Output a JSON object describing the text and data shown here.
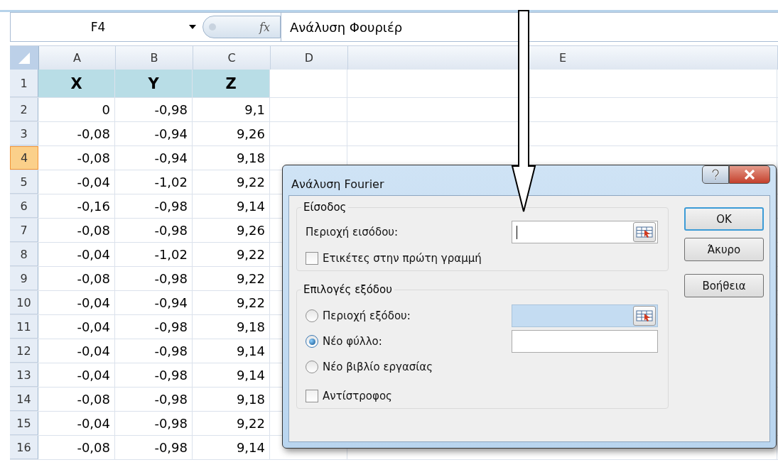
{
  "formula_bar": {
    "name_box": "F4",
    "function_label": "fx",
    "formula": "Ανάλυση Φουριέρ"
  },
  "columns": [
    {
      "label": "A"
    },
    {
      "label": "B"
    },
    {
      "label": "C"
    },
    {
      "label": "D"
    },
    {
      "label": "E"
    }
  ],
  "rows": [
    {
      "header": "1",
      "selected": false,
      "kind": "heading",
      "cells": [
        "X",
        "Y",
        "Z"
      ]
    },
    {
      "header": "2",
      "selected": false,
      "kind": "data",
      "cells": [
        "0",
        "-0,98",
        "9,1"
      ]
    },
    {
      "header": "3",
      "selected": false,
      "kind": "data",
      "cells": [
        "-0,08",
        "-0,94",
        "9,26"
      ]
    },
    {
      "header": "4",
      "selected": true,
      "kind": "data",
      "cells": [
        "-0,08",
        "-0,94",
        "9,18"
      ]
    },
    {
      "header": "5",
      "selected": false,
      "kind": "data",
      "cells": [
        "-0,04",
        "-1,02",
        "9,22"
      ]
    },
    {
      "header": "6",
      "selected": false,
      "kind": "data",
      "cells": [
        "-0,16",
        "-0,98",
        "9,14"
      ]
    },
    {
      "header": "7",
      "selected": false,
      "kind": "data",
      "cells": [
        "-0,08",
        "-0,98",
        "9,26"
      ]
    },
    {
      "header": "8",
      "selected": false,
      "kind": "data",
      "cells": [
        "-0,04",
        "-1,02",
        "9,22"
      ]
    },
    {
      "header": "9",
      "selected": false,
      "kind": "data",
      "cells": [
        "-0,08",
        "-0,98",
        "9,22"
      ]
    },
    {
      "header": "10",
      "selected": false,
      "kind": "data",
      "cells": [
        "-0,04",
        "-0,94",
        "9,22"
      ]
    },
    {
      "header": "11",
      "selected": false,
      "kind": "data",
      "cells": [
        "-0,04",
        "-0,98",
        "9,18"
      ]
    },
    {
      "header": "12",
      "selected": false,
      "kind": "data",
      "cells": [
        "-0,04",
        "-0,98",
        "9,14"
      ]
    },
    {
      "header": "13",
      "selected": false,
      "kind": "data",
      "cells": [
        "-0,04",
        "-0,98",
        "9,14"
      ]
    },
    {
      "header": "14",
      "selected": false,
      "kind": "data",
      "cells": [
        "-0,08",
        "-0,98",
        "9,18"
      ]
    },
    {
      "header": "15",
      "selected": false,
      "kind": "data",
      "cells": [
        "-0,04",
        "-0,98",
        "9,22"
      ]
    },
    {
      "header": "16",
      "selected": false,
      "kind": "data",
      "cells": [
        "-0,08",
        "-0,98",
        "9,14"
      ]
    }
  ],
  "dialog": {
    "title": "Ανάλυση Fourier",
    "input_group": {
      "legend": "Είσοδος",
      "range_label": "Περιοχή εισόδου:",
      "labels_checkbox": {
        "label": "Ετικέτες στην πρώτη γραμμή",
        "checked": false
      }
    },
    "output_group": {
      "legend": "Επιλογές εξόδου",
      "options": [
        {
          "label": "Περιοχή εξόδου:",
          "selected": false,
          "kind": "range"
        },
        {
          "label": "Νέο φύλλο:",
          "selected": true,
          "kind": "text"
        },
        {
          "label": "Νέο βιβλίο εργασίας",
          "selected": false,
          "kind": "plain"
        }
      ],
      "inverse_checkbox": {
        "label": "Αντίστροφος",
        "checked": false
      }
    },
    "buttons": [
      {
        "label": "OK",
        "default": true
      },
      {
        "label": "Άκυρο",
        "default": false
      },
      {
        "label": "Βοήθεια",
        "default": false
      }
    ]
  }
}
